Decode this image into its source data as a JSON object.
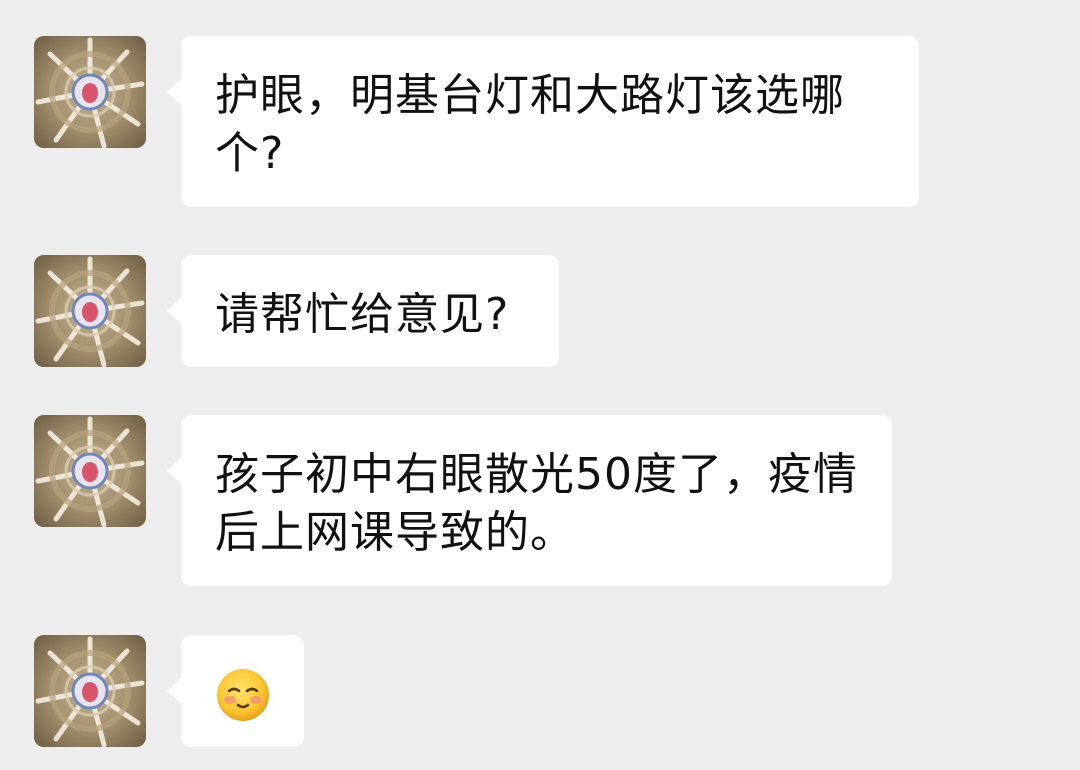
{
  "messages": [
    {
      "text": "护眼，明基台灯和大路灯该选哪个?"
    },
    {
      "text": "请帮忙给意见?"
    },
    {
      "text": "孩子初中右眼散光50度了，疫情后上网课导致的。"
    },
    {
      "emoji": "pensive-smile-emoji"
    }
  ],
  "colors": {
    "background": "#ededed",
    "bubble": "#ffffff",
    "text": "#111111"
  }
}
